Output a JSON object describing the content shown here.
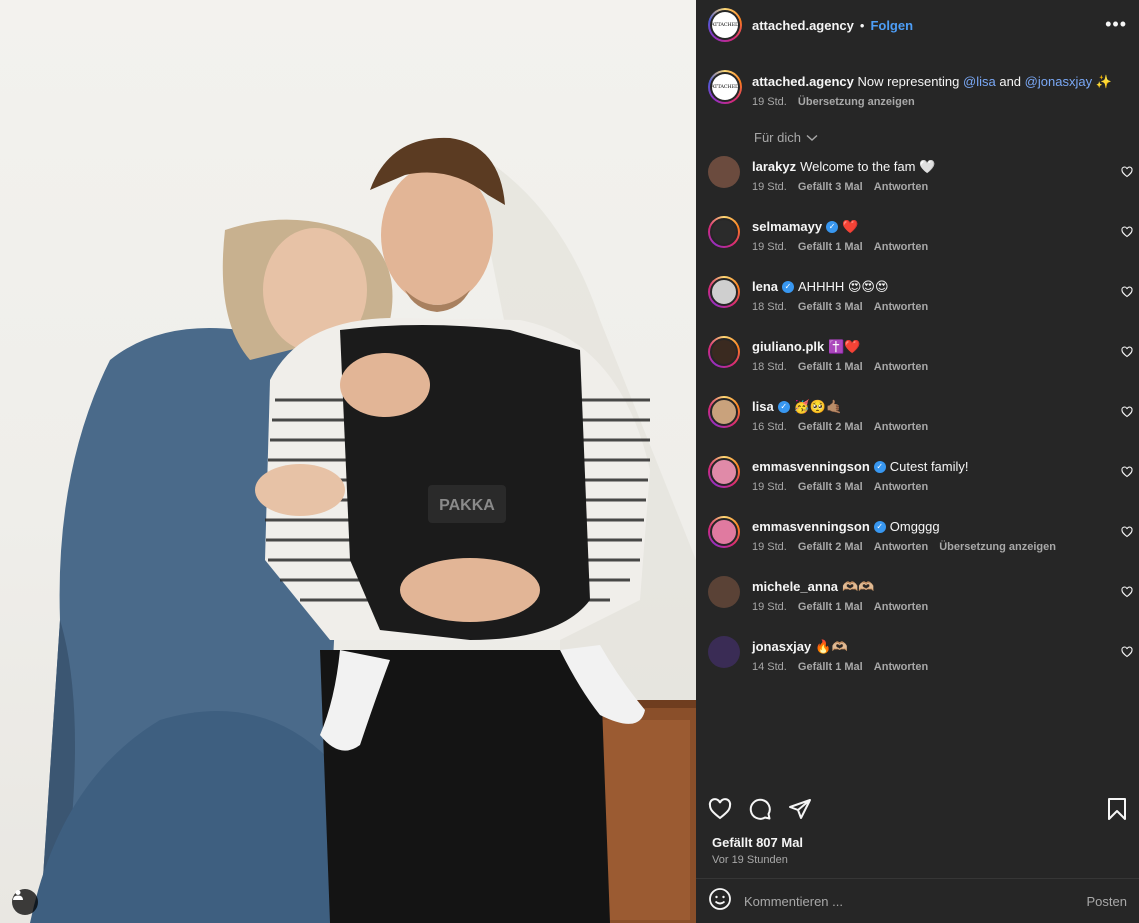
{
  "post": {
    "author": "attached.agency",
    "author_avatar_text": "ATTACHED",
    "follow_label": "Folgen",
    "separator": "•",
    "more_label": "•••"
  },
  "caption": {
    "username": "attached.agency",
    "text_prefix": "Now representing",
    "mention_1": "@lisa",
    "joiner": "and",
    "mention_2": "@jonasxjay",
    "emoji": "✨",
    "time": "19 Std.",
    "translate_label": "Übersetzung anzeigen"
  },
  "comments_filter": {
    "label": "Für dich"
  },
  "comments": [
    {
      "username": "larakyz",
      "verified": false,
      "text": "Welcome to the fam 🤍",
      "time": "19 Std.",
      "likes": "Gefällt 3 Mal",
      "reply": "Antworten",
      "extra": "",
      "ring": false,
      "avatar_color": "#6b4b3e"
    },
    {
      "username": "selmamayy",
      "verified": true,
      "text": "❤️",
      "time": "19 Std.",
      "likes": "Gefällt 1 Mal",
      "reply": "Antworten",
      "extra": "",
      "ring": true,
      "avatar_color": "#2b2b2b"
    },
    {
      "username": "lena",
      "verified": true,
      "text": "AHHHH 😍😍😍",
      "time": "18 Std.",
      "likes": "Gefällt 3 Mal",
      "reply": "Antworten",
      "extra": "",
      "ring": true,
      "avatar_color": "#cfcfcf"
    },
    {
      "username": "giuliano.plk",
      "verified": false,
      "text": "✝️❤️",
      "time": "18 Std.",
      "likes": "Gefällt 1 Mal",
      "reply": "Antworten",
      "extra": "",
      "ring": true,
      "avatar_color": "#3a2a20"
    },
    {
      "username": "lisa",
      "verified": true,
      "text": "🥳🥺🤙🏽",
      "time": "16 Std.",
      "likes": "Gefällt 2 Mal",
      "reply": "Antworten",
      "extra": "",
      "ring": true,
      "avatar_color": "#c9a27c"
    },
    {
      "username": "emmasvenningson",
      "verified": true,
      "text": "Cutest family!",
      "time": "19 Std.",
      "likes": "Gefällt 3 Mal",
      "reply": "Antworten",
      "extra": "",
      "ring": true,
      "avatar_color": "#e08aa8"
    },
    {
      "username": "emmasvenningson",
      "verified": true,
      "text": "Omgggg",
      "time": "19 Std.",
      "likes": "Gefällt 2 Mal",
      "reply": "Antworten",
      "extra": "Übersetzung anzeigen",
      "ring": true,
      "avatar_color": "#e07aa0"
    },
    {
      "username": "michele_anna",
      "verified": false,
      "text": "🫶🏼🫶🏼",
      "time": "19 Std.",
      "likes": "Gefällt 1 Mal",
      "reply": "Antworten",
      "extra": "",
      "ring": false,
      "avatar_color": "#5a4236"
    },
    {
      "username": "jonasxjay",
      "verified": false,
      "text": "🔥🫶🏼",
      "time": "14 Std.",
      "likes": "Gefällt 1 Mal",
      "reply": "Antworten",
      "extra": "",
      "ring": false,
      "avatar_color": "#3a2c55"
    }
  ],
  "footer": {
    "likes_label": "Gefällt 807 Mal",
    "posted_ago": "Vor 19 Stunden",
    "comment_placeholder": "Kommentieren ...",
    "post_button": "Posten"
  },
  "photo": {
    "carrier_text": "PAKKA"
  },
  "colors": {
    "panel_bg": "#262626",
    "link": "#4d9ef7",
    "mention": "#7aa8f5",
    "muted": "#a8a8a8",
    "verified": "#3897f0"
  }
}
